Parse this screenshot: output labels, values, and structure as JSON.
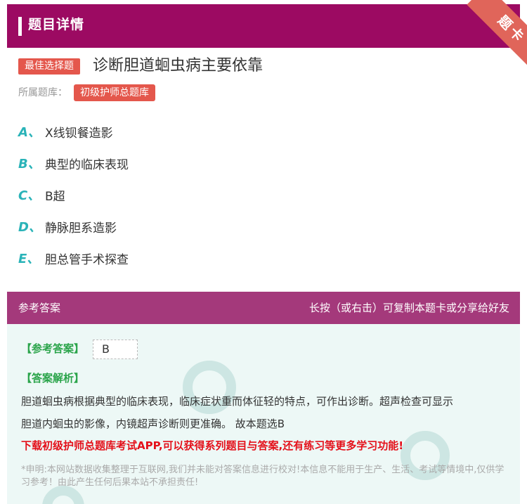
{
  "header": {
    "title": "题目详情",
    "ribbon_label": "题卡"
  },
  "question": {
    "type_badge": "最佳选择题",
    "title": "诊断胆道蛔虫病主要依靠",
    "bank_label": "所属题库：",
    "bank_name": "初级护师总题库"
  },
  "options": [
    {
      "letter": "A、",
      "text": "X线钡餐造影"
    },
    {
      "letter": "B、",
      "text": "典型的临床表现"
    },
    {
      "letter": "C、",
      "text": "B超"
    },
    {
      "letter": "D、",
      "text": "静脉胆系造影"
    },
    {
      "letter": "E、",
      "text": "胆总管手术探查"
    }
  ],
  "answer_section": {
    "title": "参考答案",
    "hint": "长按（或右击）可复制本题卡或分享给好友",
    "ref_label": "【参考答案】",
    "ref_value": "B",
    "analysis_label": "【答案解析】",
    "analysis_lines": [
      "胆道蛔虫病根据典型的临床表现，临床症状重而体征轻的特点，可作出诊断。超声检查可显示",
      "胆道内蛔虫的影像，内镜超声诊断则更准确。 故本题选B"
    ],
    "promo": "下载初级护师总题库考试APP,可以获得系列题目与答案,还有练习等更多学习功能!",
    "disclaimer": "*申明:本网站数据收集整理于互联网,我们并未能对答案信息进行校对!本信息不能用于生产、生活、考试等情境中,仅供学习参考！由此产生任何后果本站不承担责任!"
  },
  "colors": {
    "header_bg": "#9c0a62",
    "answer_head_bg": "#a4397b",
    "badge_red": "#e4574c",
    "option_letter": "#2ab3b8",
    "answer_green": "#2aa44a",
    "promo_red": "#e4101a",
    "answer_body_bg": "#edf8f6"
  }
}
